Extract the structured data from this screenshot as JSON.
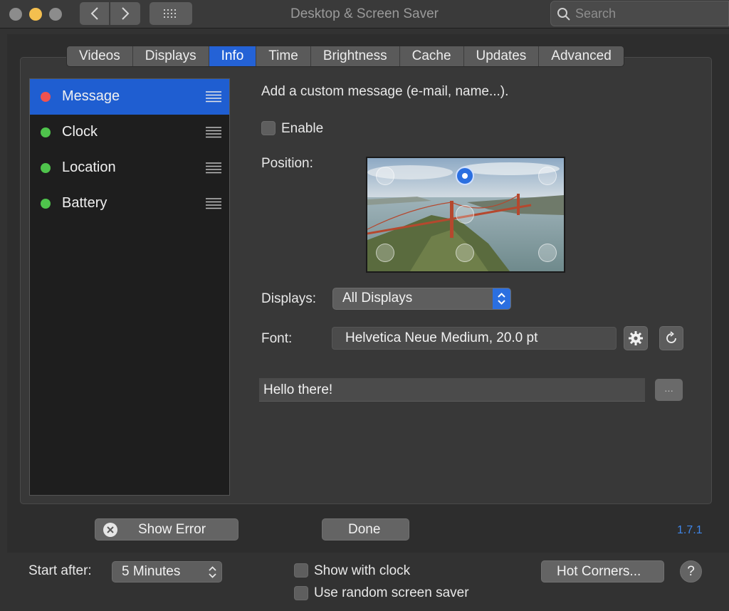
{
  "window": {
    "title": "Desktop & Screen Saver",
    "search_placeholder": "Search"
  },
  "tabs": [
    {
      "label": "Videos",
      "active": false
    },
    {
      "label": "Displays",
      "active": false
    },
    {
      "label": "Info",
      "active": true
    },
    {
      "label": "Time",
      "active": false
    },
    {
      "label": "Brightness",
      "active": false
    },
    {
      "label": "Cache",
      "active": false
    },
    {
      "label": "Updates",
      "active": false
    },
    {
      "label": "Advanced",
      "active": false
    }
  ],
  "info_list": [
    {
      "label": "Message",
      "status_color": "#f0524f",
      "selected": true
    },
    {
      "label": "Clock",
      "status_color": "#4fc44c",
      "selected": false
    },
    {
      "label": "Location",
      "status_color": "#4fc44c",
      "selected": false
    },
    {
      "label": "Battery",
      "status_color": "#4fc44c",
      "selected": false
    }
  ],
  "detail": {
    "description": "Add a custom message (e-mail, name...).",
    "enable_label": "Enable",
    "enable_checked": false,
    "position_label": "Position:",
    "position_selected": "top-center",
    "displays_label": "Displays:",
    "displays_value": "All Displays",
    "font_label": "Font:",
    "font_value": "Helvetica Neue Medium, 20.0 pt",
    "message_value": "Hello there!",
    "more_button_label": "..."
  },
  "footer": {
    "show_error_label": "Show Error",
    "done_label": "Done",
    "version": "1.7.1"
  },
  "bottom_bar": {
    "start_after_label": "Start after:",
    "start_after_value": "5 Minutes",
    "show_clock_label": "Show with clock",
    "random_label": "Use random screen saver",
    "hot_corners_label": "Hot Corners...",
    "help_label": "?"
  },
  "colors": {
    "accent": "#2462d6",
    "background": "#323232",
    "version_link": "#3f86e8"
  }
}
